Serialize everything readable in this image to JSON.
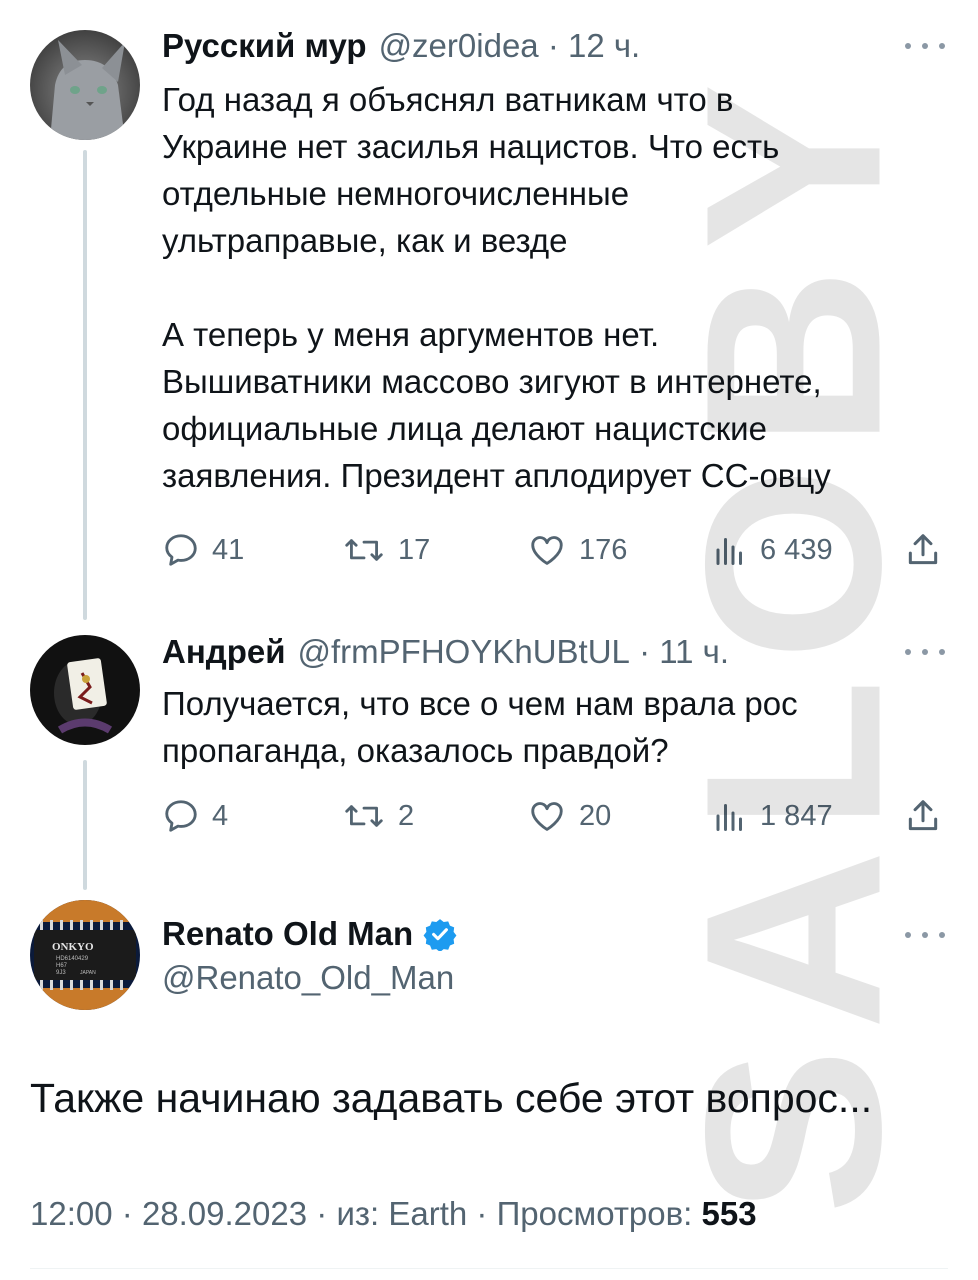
{
  "watermark": "SALOBY",
  "tweets": [
    {
      "name": "Русский мур",
      "handle": "@zer0idea",
      "time": "12 ч.",
      "text": "Год назад я объяснял ватникам что в\nУкраине нет засилья нацистов. Что есть\nотдельные немногочисленные\nультраправые, как и везде\n\nА теперь у меня аргументов нет.\nВышиватники массово зигуют в интернете,\nофициальные лица делают нацистские\nзаявления. Президент аплодирует СС-овцу",
      "replies": "41",
      "retweets": "17",
      "likes": "176",
      "views": "6 439"
    },
    {
      "name": "Андрей",
      "handle": "@frmPFHOYKhUBtUL",
      "time": "11 ч.",
      "text": "Получается, что все о чем нам врала рос\nпропаганда, оказалось правдой?",
      "replies": "4",
      "retweets": "2",
      "likes": "20",
      "views": "1 847"
    }
  ],
  "main_tweet": {
    "name": "Renato Old Man",
    "handle": "@Renato_Old_Man",
    "text": "Также начинаю задавать себе этот вопрос...",
    "time": "12:00",
    "date": "28.09.2023",
    "source_prefix": "из:",
    "source": "Earth",
    "views_label": "Просмотров:",
    "views": "553",
    "avatar_chip_text": [
      "ONKYO",
      "HD6140429",
      "H67",
      "9J3",
      "JAPAN"
    ]
  },
  "colors": {
    "text": "#0f1419",
    "secondary": "#536471",
    "verified": "#1d9bf0",
    "thread_line": "#cfd9de"
  }
}
